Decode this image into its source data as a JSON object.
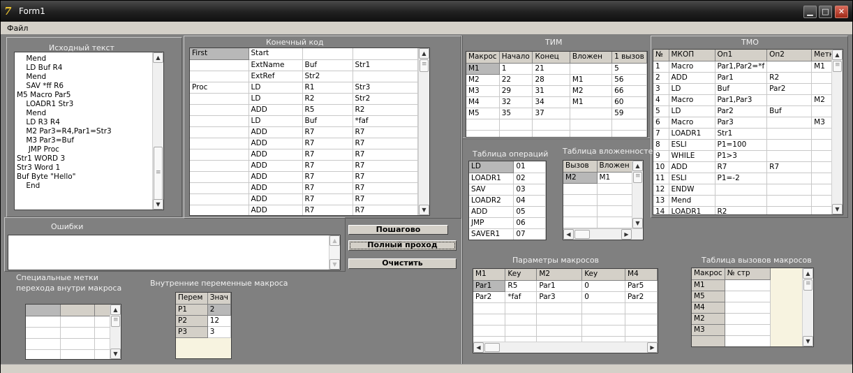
{
  "window": {
    "title": "Form1"
  },
  "menu": {
    "file": "Файл"
  },
  "source": {
    "title": "Исходный текст",
    "lines": [
      "    Mend",
      "    LD Buf R4",
      "    Mend",
      "    SAV *ff R6",
      "M5 Macro Par5",
      "    LOADR1 Str3",
      "    Mend",
      "    LD R3 R4",
      "    M2 Par3=R4,Par1=Str3",
      "    M3 Par3=Buf",
      "     JMP Proc",
      "Str1 WORD 3",
      "Str3 Word 1",
      "Buf Byte \"Hello\"",
      "    End"
    ]
  },
  "final_code": {
    "title": "Конечный код",
    "rows": [
      [
        "First",
        "Start",
        "",
        ""
      ],
      [
        "",
        "ExtName",
        "Buf",
        "Str1"
      ],
      [
        "",
        "ExtRef",
        "Str2",
        ""
      ],
      [
        "Proc",
        "LD",
        "R1",
        "Str3"
      ],
      [
        "",
        "LD",
        "R2",
        "Str2"
      ],
      [
        "",
        "ADD",
        "R5",
        "R2"
      ],
      [
        "",
        "LD",
        "Buf",
        "*faf"
      ],
      [
        "",
        "ADD",
        "R7",
        "R7"
      ],
      [
        "",
        "ADD",
        "R7",
        "R7"
      ],
      [
        "",
        "ADD",
        "R7",
        "R7"
      ],
      [
        "",
        "ADD",
        "R7",
        "R7"
      ],
      [
        "",
        "ADD",
        "R7",
        "R7"
      ],
      [
        "",
        "ADD",
        "R7",
        "R7"
      ],
      [
        "",
        "ADD",
        "R7",
        "R7"
      ],
      [
        "",
        "ADD",
        "R7",
        "R7"
      ]
    ]
  },
  "errors": {
    "title": "Ошибки"
  },
  "buttons": {
    "step": "Пошагово",
    "full": "Полный проход",
    "clear": "Очистить"
  },
  "tim": {
    "title": "ТИМ",
    "headers": [
      "Макрос",
      "Начало",
      "Конец",
      "Вложен",
      "1 вызов"
    ],
    "rows": [
      [
        "M1",
        "1",
        "21",
        "",
        "5"
      ],
      [
        "M2",
        "22",
        "28",
        "M1",
        "56"
      ],
      [
        "M3",
        "29",
        "31",
        "M2",
        "66"
      ],
      [
        "M4",
        "32",
        "34",
        "M1",
        "60"
      ],
      [
        "M5",
        "35",
        "37",
        "",
        "59"
      ]
    ]
  },
  "tmo": {
    "title": "ТМО",
    "headers": [
      "№",
      "МКОП",
      "Оп1",
      "Оп2",
      "Метка"
    ],
    "rows": [
      [
        "1",
        "Macro",
        "Par1,Par2=*f",
        "",
        "M1"
      ],
      [
        "2",
        "ADD",
        "Par1",
        "R2",
        ""
      ],
      [
        "3",
        "LD",
        "Buf",
        "Par2",
        ""
      ],
      [
        "4",
        "Macro",
        "Par1,Par3",
        "",
        "M2"
      ],
      [
        "5",
        "LD",
        "Par2",
        "Buf",
        ""
      ],
      [
        "6",
        "Macro",
        "Par3",
        "",
        "M3"
      ],
      [
        "7",
        "LOADR1",
        "Str1",
        "",
        ""
      ],
      [
        "8",
        "ESLI",
        "P1=100",
        "",
        ""
      ],
      [
        "9",
        "WHILE",
        "P1>3",
        "",
        ""
      ],
      [
        "10",
        "ADD",
        "R7",
        "R7",
        ""
      ],
      [
        "11",
        "ESLI",
        "P1=-2",
        "",
        ""
      ],
      [
        "12",
        "ENDW",
        "",
        "",
        ""
      ],
      [
        "13",
        "Mend",
        "",
        "",
        ""
      ],
      [
        "14",
        "LOADR1",
        "R2",
        "",
        ""
      ]
    ]
  },
  "ops": {
    "title": "Таблица операций",
    "rows": [
      [
        "LD",
        "01"
      ],
      [
        "LOADR1",
        "02"
      ],
      [
        "SAV",
        "03"
      ],
      [
        "LOADR2",
        "04"
      ],
      [
        "ADD",
        "05"
      ],
      [
        "JMP",
        "06"
      ],
      [
        "SAVER1",
        "07"
      ]
    ]
  },
  "nest": {
    "title": "Таблица вложенностей",
    "headers": [
      "Вызов",
      "Вложен в"
    ],
    "rows": [
      [
        "M2",
        "M1"
      ]
    ]
  },
  "params": {
    "title": "Параметры макросов",
    "headers": [
      "M1",
      "Key",
      "M2",
      "Key",
      "M4"
    ],
    "rows": [
      [
        "Par1",
        "R5",
        "Par1",
        "0",
        "Par5"
      ],
      [
        "Par2",
        "*faf",
        "Par3",
        "0",
        "Par2"
      ]
    ]
  },
  "calls": {
    "title": "Таблица вызовов макросов",
    "headers": [
      "Макрос",
      "№ стр"
    ],
    "rows": [
      "M1",
      "M5",
      "M4",
      "M2",
      "M3"
    ]
  },
  "labels": {
    "title_line1": "Специальные метки",
    "title_line2": "перехода внутри макроса"
  },
  "vars": {
    "title": "Внутренние переменные макроса",
    "headers": [
      "Перем",
      "Знач"
    ],
    "rows": [
      [
        "P1",
        "2"
      ],
      [
        "P2",
        "12"
      ],
      [
        "P3",
        "3"
      ]
    ]
  }
}
